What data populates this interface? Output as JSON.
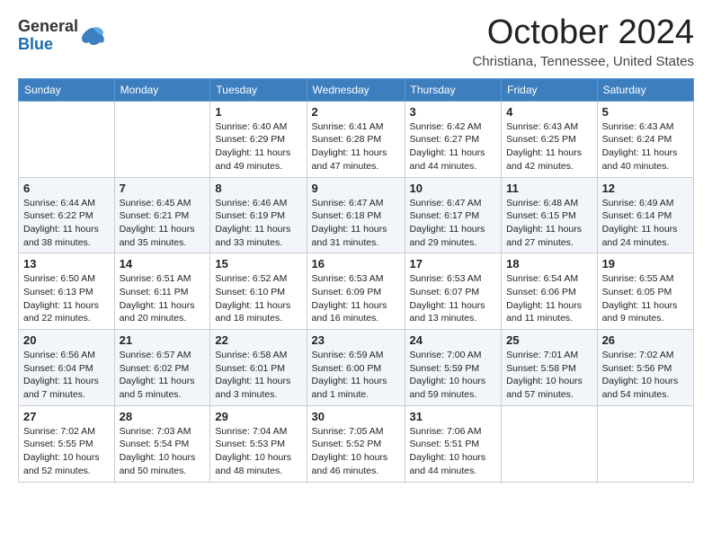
{
  "header": {
    "logo_general": "General",
    "logo_blue": "Blue",
    "month_title": "October 2024",
    "subtitle": "Christiana, Tennessee, United States"
  },
  "days_of_week": [
    "Sunday",
    "Monday",
    "Tuesday",
    "Wednesday",
    "Thursday",
    "Friday",
    "Saturday"
  ],
  "weeks": [
    [
      {
        "day": "",
        "sunrise": "",
        "sunset": "",
        "daylight": ""
      },
      {
        "day": "",
        "sunrise": "",
        "sunset": "",
        "daylight": ""
      },
      {
        "day": "1",
        "sunrise": "Sunrise: 6:40 AM",
        "sunset": "Sunset: 6:29 PM",
        "daylight": "Daylight: 11 hours and 49 minutes."
      },
      {
        "day": "2",
        "sunrise": "Sunrise: 6:41 AM",
        "sunset": "Sunset: 6:28 PM",
        "daylight": "Daylight: 11 hours and 47 minutes."
      },
      {
        "day": "3",
        "sunrise": "Sunrise: 6:42 AM",
        "sunset": "Sunset: 6:27 PM",
        "daylight": "Daylight: 11 hours and 44 minutes."
      },
      {
        "day": "4",
        "sunrise": "Sunrise: 6:43 AM",
        "sunset": "Sunset: 6:25 PM",
        "daylight": "Daylight: 11 hours and 42 minutes."
      },
      {
        "day": "5",
        "sunrise": "Sunrise: 6:43 AM",
        "sunset": "Sunset: 6:24 PM",
        "daylight": "Daylight: 11 hours and 40 minutes."
      }
    ],
    [
      {
        "day": "6",
        "sunrise": "Sunrise: 6:44 AM",
        "sunset": "Sunset: 6:22 PM",
        "daylight": "Daylight: 11 hours and 38 minutes."
      },
      {
        "day": "7",
        "sunrise": "Sunrise: 6:45 AM",
        "sunset": "Sunset: 6:21 PM",
        "daylight": "Daylight: 11 hours and 35 minutes."
      },
      {
        "day": "8",
        "sunrise": "Sunrise: 6:46 AM",
        "sunset": "Sunset: 6:19 PM",
        "daylight": "Daylight: 11 hours and 33 minutes."
      },
      {
        "day": "9",
        "sunrise": "Sunrise: 6:47 AM",
        "sunset": "Sunset: 6:18 PM",
        "daylight": "Daylight: 11 hours and 31 minutes."
      },
      {
        "day": "10",
        "sunrise": "Sunrise: 6:47 AM",
        "sunset": "Sunset: 6:17 PM",
        "daylight": "Daylight: 11 hours and 29 minutes."
      },
      {
        "day": "11",
        "sunrise": "Sunrise: 6:48 AM",
        "sunset": "Sunset: 6:15 PM",
        "daylight": "Daylight: 11 hours and 27 minutes."
      },
      {
        "day": "12",
        "sunrise": "Sunrise: 6:49 AM",
        "sunset": "Sunset: 6:14 PM",
        "daylight": "Daylight: 11 hours and 24 minutes."
      }
    ],
    [
      {
        "day": "13",
        "sunrise": "Sunrise: 6:50 AM",
        "sunset": "Sunset: 6:13 PM",
        "daylight": "Daylight: 11 hours and 22 minutes."
      },
      {
        "day": "14",
        "sunrise": "Sunrise: 6:51 AM",
        "sunset": "Sunset: 6:11 PM",
        "daylight": "Daylight: 11 hours and 20 minutes."
      },
      {
        "day": "15",
        "sunrise": "Sunrise: 6:52 AM",
        "sunset": "Sunset: 6:10 PM",
        "daylight": "Daylight: 11 hours and 18 minutes."
      },
      {
        "day": "16",
        "sunrise": "Sunrise: 6:53 AM",
        "sunset": "Sunset: 6:09 PM",
        "daylight": "Daylight: 11 hours and 16 minutes."
      },
      {
        "day": "17",
        "sunrise": "Sunrise: 6:53 AM",
        "sunset": "Sunset: 6:07 PM",
        "daylight": "Daylight: 11 hours and 13 minutes."
      },
      {
        "day": "18",
        "sunrise": "Sunrise: 6:54 AM",
        "sunset": "Sunset: 6:06 PM",
        "daylight": "Daylight: 11 hours and 11 minutes."
      },
      {
        "day": "19",
        "sunrise": "Sunrise: 6:55 AM",
        "sunset": "Sunset: 6:05 PM",
        "daylight": "Daylight: 11 hours and 9 minutes."
      }
    ],
    [
      {
        "day": "20",
        "sunrise": "Sunrise: 6:56 AM",
        "sunset": "Sunset: 6:04 PM",
        "daylight": "Daylight: 11 hours and 7 minutes."
      },
      {
        "day": "21",
        "sunrise": "Sunrise: 6:57 AM",
        "sunset": "Sunset: 6:02 PM",
        "daylight": "Daylight: 11 hours and 5 minutes."
      },
      {
        "day": "22",
        "sunrise": "Sunrise: 6:58 AM",
        "sunset": "Sunset: 6:01 PM",
        "daylight": "Daylight: 11 hours and 3 minutes."
      },
      {
        "day": "23",
        "sunrise": "Sunrise: 6:59 AM",
        "sunset": "Sunset: 6:00 PM",
        "daylight": "Daylight: 11 hours and 1 minute."
      },
      {
        "day": "24",
        "sunrise": "Sunrise: 7:00 AM",
        "sunset": "Sunset: 5:59 PM",
        "daylight": "Daylight: 10 hours and 59 minutes."
      },
      {
        "day": "25",
        "sunrise": "Sunrise: 7:01 AM",
        "sunset": "Sunset: 5:58 PM",
        "daylight": "Daylight: 10 hours and 57 minutes."
      },
      {
        "day": "26",
        "sunrise": "Sunrise: 7:02 AM",
        "sunset": "Sunset: 5:56 PM",
        "daylight": "Daylight: 10 hours and 54 minutes."
      }
    ],
    [
      {
        "day": "27",
        "sunrise": "Sunrise: 7:02 AM",
        "sunset": "Sunset: 5:55 PM",
        "daylight": "Daylight: 10 hours and 52 minutes."
      },
      {
        "day": "28",
        "sunrise": "Sunrise: 7:03 AM",
        "sunset": "Sunset: 5:54 PM",
        "daylight": "Daylight: 10 hours and 50 minutes."
      },
      {
        "day": "29",
        "sunrise": "Sunrise: 7:04 AM",
        "sunset": "Sunset: 5:53 PM",
        "daylight": "Daylight: 10 hours and 48 minutes."
      },
      {
        "day": "30",
        "sunrise": "Sunrise: 7:05 AM",
        "sunset": "Sunset: 5:52 PM",
        "daylight": "Daylight: 10 hours and 46 minutes."
      },
      {
        "day": "31",
        "sunrise": "Sunrise: 7:06 AM",
        "sunset": "Sunset: 5:51 PM",
        "daylight": "Daylight: 10 hours and 44 minutes."
      },
      {
        "day": "",
        "sunrise": "",
        "sunset": "",
        "daylight": ""
      },
      {
        "day": "",
        "sunrise": "",
        "sunset": "",
        "daylight": ""
      }
    ]
  ]
}
